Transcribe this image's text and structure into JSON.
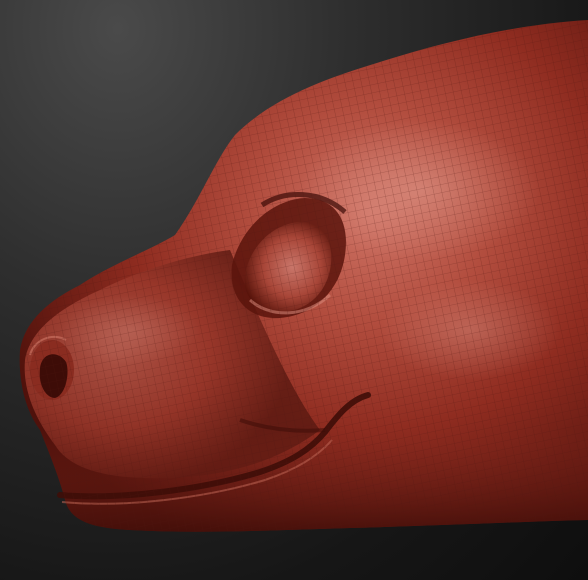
{
  "scene": {
    "subject": "sculpt-head",
    "colors": {
      "background_top": "#4a4a4a",
      "background_bottom": "#0e0e0e",
      "clay_base": "#9e2e22",
      "clay_light": "#c8685a",
      "clay_shadow": "#4a0f0a",
      "wireframe": "#5a1812"
    },
    "icons": [
      "sculpt-head",
      "eye-socket",
      "nostril",
      "mouth-line",
      "wireframe-grid"
    ]
  }
}
